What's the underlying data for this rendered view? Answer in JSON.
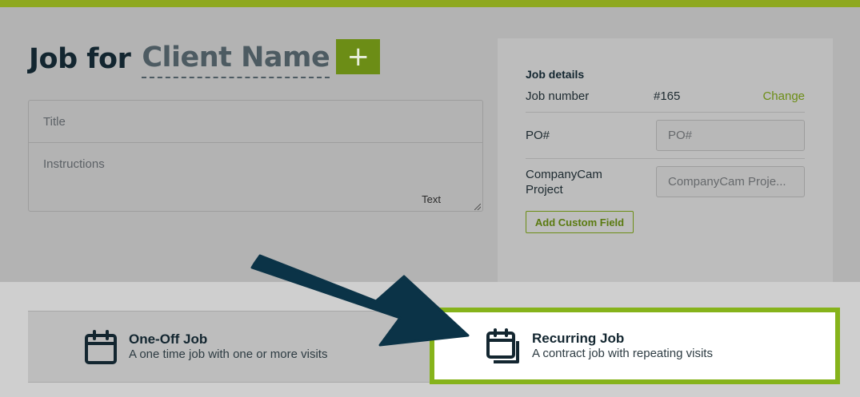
{
  "heading": {
    "prefix": "Job for",
    "client": "Client Name",
    "add_button": "+"
  },
  "form": {
    "title_placeholder": "Title",
    "instructions_placeholder": "Instructions",
    "text_hint": "Text"
  },
  "details": {
    "title": "Job details",
    "job_number_label": "Job number",
    "job_number_value": "#165",
    "change_label": "Change",
    "po_label": "PO#",
    "po_placeholder": "PO#",
    "companycam_label_1": "CompanyCam",
    "companycam_label_2": "Project",
    "companycam_placeholder": "CompanyCam Proje...",
    "custom_field_button": "Add Custom Field"
  },
  "job_types": [
    {
      "title": "One-Off Job",
      "description": "A one time job with one or more visits",
      "icon": "calendar-icon",
      "selected": false
    },
    {
      "title": "Recurring Job",
      "description": "A contract job with repeating visits",
      "icon": "calendar-stack-icon",
      "selected": true
    }
  ],
  "colors": {
    "accent_green": "#86b31b",
    "button_green": "#6c8d16",
    "arrow_navy": "#0b3347",
    "overlay_gray": "#b3b3b3"
  }
}
